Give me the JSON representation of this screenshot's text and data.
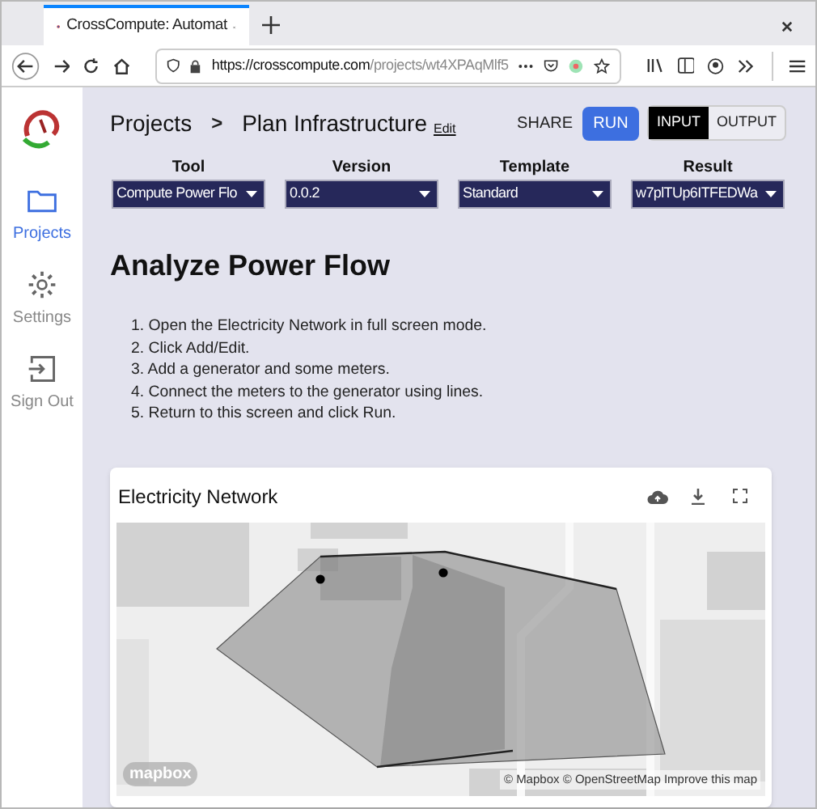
{
  "browser": {
    "tab_title": "CrossCompute: Automat",
    "url_host": "https://crosscompute.com",
    "url_path": "/projects/wt4XPAqMlf5"
  },
  "sidebar": {
    "items": [
      {
        "label": "Projects",
        "kind": "folder",
        "selected": true
      },
      {
        "label": "Settings",
        "kind": "gear",
        "selected": false
      },
      {
        "label": "Sign Out",
        "kind": "signout",
        "selected": false
      }
    ]
  },
  "header": {
    "breadcrumb": [
      "Projects",
      "Plan Infrastructure"
    ],
    "separator": ">",
    "edit": "Edit",
    "share": "SHARE",
    "run": "RUN",
    "modes": [
      {
        "label": "INPUT",
        "selected": true
      },
      {
        "label": "OUTPUT",
        "selected": false
      }
    ]
  },
  "selects": [
    {
      "label": "Tool",
      "value": "Compute Power Flo"
    },
    {
      "label": "Version",
      "value": "0.0.2"
    },
    {
      "label": "Template",
      "value": "Standard"
    },
    {
      "label": "Result",
      "value": "w7plTUp6ITFEDWa"
    }
  ],
  "heading": "Analyze Power Flow",
  "steps": [
    "1. Open the Electricity Network in full screen mode.",
    "2. Click Add/Edit.",
    "3. Add a generator and some meters.",
    "4. Connect the meters to the generator using lines.",
    "5. Return to this screen and click Run."
  ],
  "card": {
    "title": "Electricity Network",
    "map_logo": "mapbox",
    "attribution": "© Mapbox © OpenStreetMap Improve this map"
  }
}
